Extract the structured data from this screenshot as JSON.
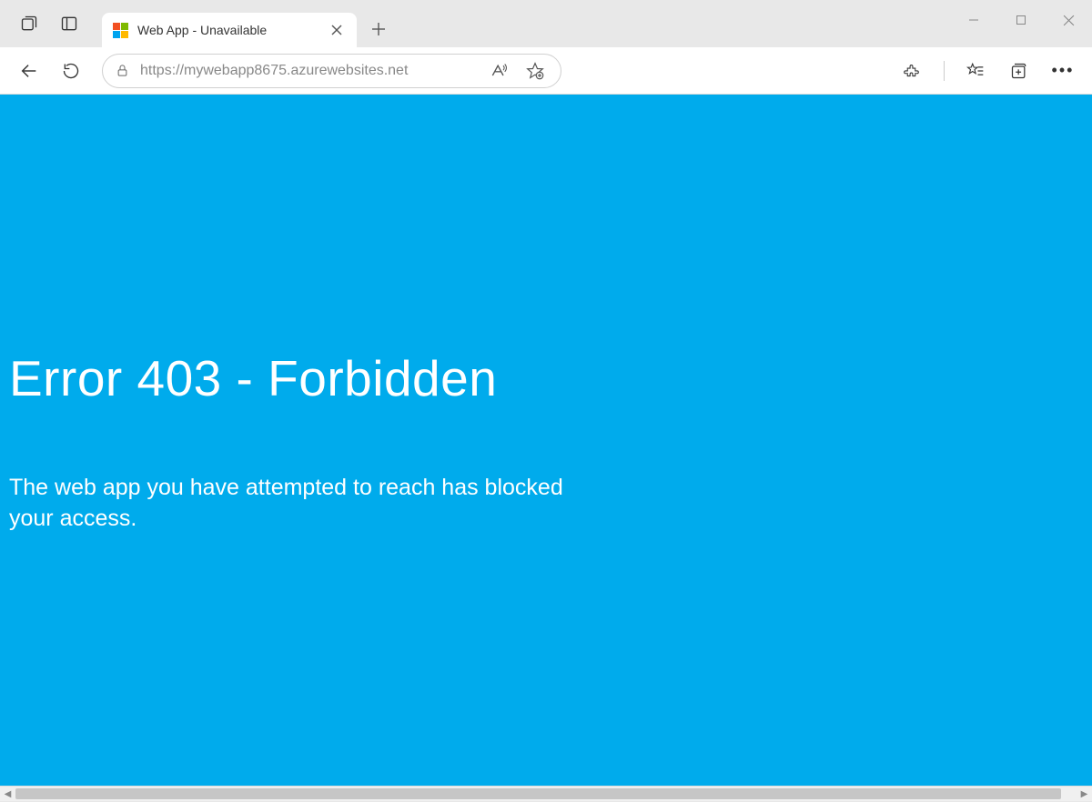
{
  "browser": {
    "tab_title": "Web App - Unavailable",
    "url": "https://mywebapp8675.azurewebsites.net"
  },
  "page": {
    "error_title": "Error 403 - Forbidden",
    "error_message": "The web app you have attempted to reach has blocked your access.",
    "background_color": "#00abec"
  },
  "icons": {
    "tab_actions": "tab-actions",
    "vertical_tabs": "vertical-tabs",
    "close": "close",
    "new_tab": "new-tab",
    "back": "back",
    "refresh": "refresh",
    "lock": "lock",
    "read_aloud": "read-aloud",
    "favorite": "favorite-add",
    "extensions": "extensions",
    "favorites": "favorites",
    "collections": "collections",
    "menu": "more-menu",
    "minimize": "minimize",
    "maximize": "maximize",
    "win_close": "close"
  }
}
